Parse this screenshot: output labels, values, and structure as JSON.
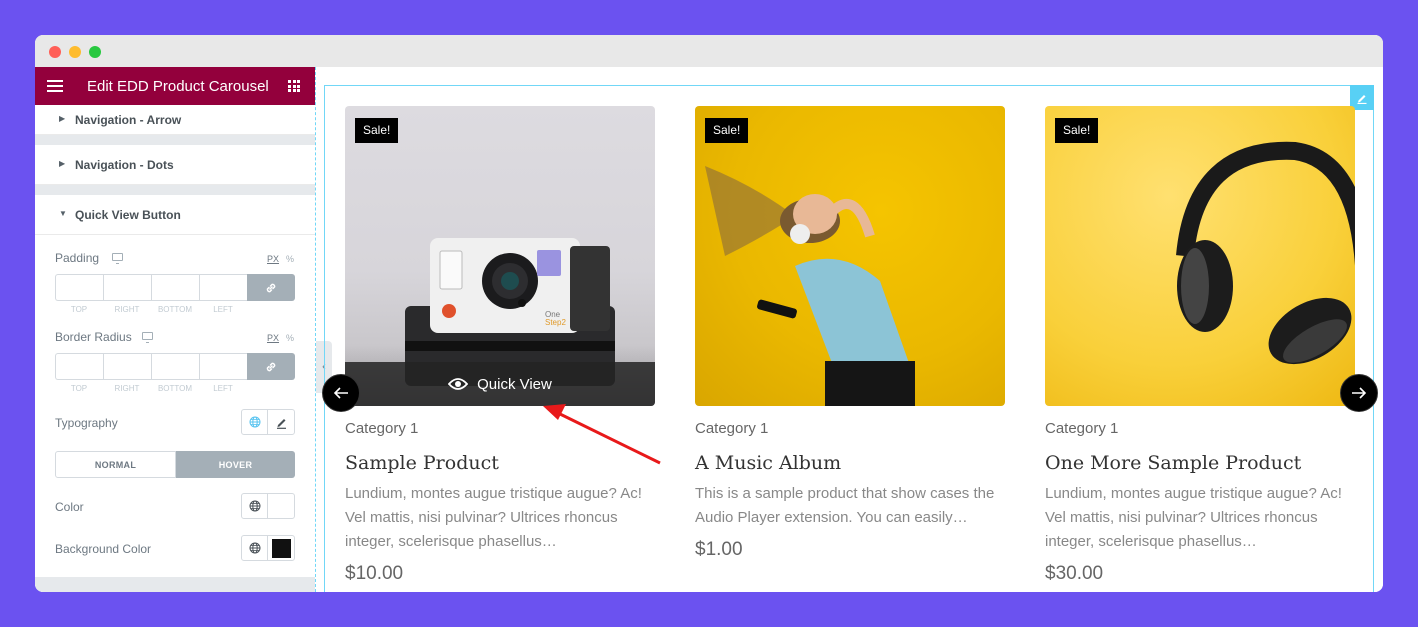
{
  "window": {
    "controls": [
      "close",
      "minimize",
      "maximize"
    ]
  },
  "sidebar": {
    "title": "Edit EDD Product Carousel",
    "menu_icon": "hamburger-icon",
    "apps_icon": "grid-icon",
    "sections": [
      {
        "label": "Navigation - Arrow",
        "expanded": false
      },
      {
        "label": "Navigation - Dots",
        "expanded": false
      },
      {
        "label": "Quick View Button",
        "expanded": true
      }
    ],
    "controls": {
      "padding": {
        "label": "Padding",
        "unit_px": "PX",
        "unit_pct": "%",
        "fields": [
          "TOP",
          "RIGHT",
          "BOTTOM",
          "LEFT"
        ],
        "values": [
          "",
          "",
          "",
          ""
        ]
      },
      "border_radius": {
        "label": "Border Radius",
        "unit_px": "PX",
        "unit_pct": "%",
        "fields": [
          "TOP",
          "RIGHT",
          "BOTTOM",
          "LEFT"
        ],
        "values": [
          "",
          "",
          "",
          ""
        ]
      },
      "typography": {
        "label": "Typography"
      },
      "state_tabs": {
        "normal": "NORMAL",
        "hover": "HOVER",
        "active": "hover"
      },
      "color": {
        "label": "Color",
        "value": ""
      },
      "background_color": {
        "label": "Background Color",
        "value": "#111111"
      }
    }
  },
  "preview": {
    "products": [
      {
        "badge": "Sale!",
        "image": "polaroid-camera",
        "category": "Category 1",
        "name": "Sample Product",
        "description": "Lundium, montes augue tristique augue? Ac! Vel mattis, nisi pulvinar? Ultrices rhoncus integer, scelerisque phasellus…",
        "price": "$10.00",
        "quick_view": "Quick View"
      },
      {
        "badge": "Sale!",
        "image": "woman-headphones",
        "category": "Category 1",
        "name": "A Music Album",
        "description": "This is a sample product that show cases the Audio Player extension. You can easily…",
        "price": "$1.00"
      },
      {
        "badge": "Sale!",
        "image": "black-headphones",
        "category": "Category 1",
        "name": "One More Sample Product",
        "description": "Lundium, montes augue tristique augue? Ac! Vel mattis, nisi pulvinar? Ultrices rhoncus integer, scelerisque phasellus…",
        "price": "$30.00"
      }
    ],
    "prev_icon": "arrow-left-icon",
    "next_icon": "arrow-right-icon"
  },
  "colors": {
    "background": "#6b52f0",
    "header": "#93003c",
    "accent": "#71d7f7",
    "annotation_arrow": "#e8191a"
  }
}
